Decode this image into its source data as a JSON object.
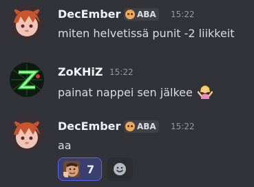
{
  "messages": [
    {
      "author": "DecEmber",
      "tag_label": "ABA",
      "time": "15:22",
      "text": "miten helvetissä punit -2 liikkeit",
      "avatar_icon": "anime-character-avatar"
    },
    {
      "author": "ZoKHiZ",
      "time": "15:22",
      "text": "painat nappei sen jälkee",
      "emoji_icon": "woman-shrugging-emoji",
      "avatar_icon": "green-z-logo-avatar"
    },
    {
      "author": "DecEmber",
      "tag_label": "ABA",
      "time": "15:22",
      "text": "aa",
      "avatar_icon": "anime-character-avatar",
      "reaction": {
        "emoji_icon": "face-custom-emoji",
        "count": "7"
      },
      "add_reaction_icon": "add-reaction-icon"
    }
  ],
  "colors": {
    "background": "#313338",
    "tag_background": "#3f4147",
    "reaction_background": "#3b3f6e",
    "reaction_border": "#5865f2",
    "timestamp": "#949ba4"
  }
}
